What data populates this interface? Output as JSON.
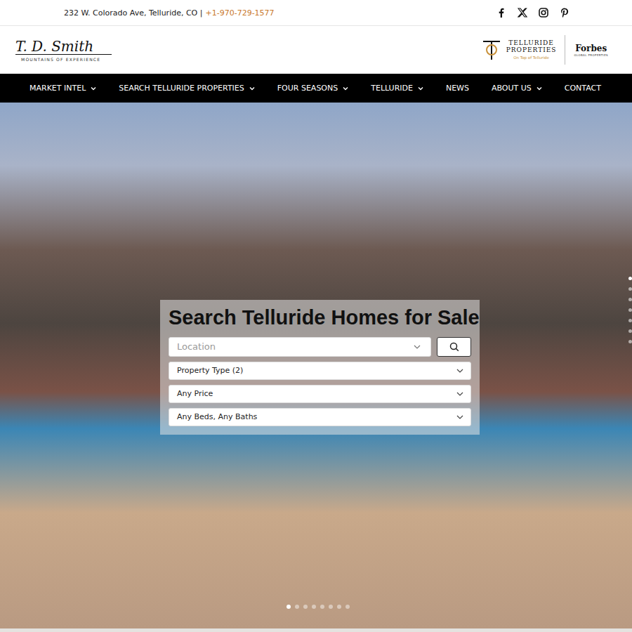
{
  "top_bar": {
    "address": "232 W. Colorado Ave, Telluride, CO |",
    "phone": "+1-970-729-1577",
    "social": [
      {
        "network": "facebook"
      },
      {
        "network": "x"
      },
      {
        "network": "instagram"
      },
      {
        "network": "pinterest"
      }
    ]
  },
  "header": {
    "logo": {
      "name": "T. D. Smith",
      "tagline": "MOUNTAINS OF EXPERIENCE"
    },
    "brand": {
      "line1": "TELLURIDE",
      "line2": "PROPERTIES",
      "slogan": "On Top of Telluride",
      "partner": "Forbes",
      "partner_sub": "GLOBAL PROPERTIES"
    }
  },
  "nav": [
    {
      "label": "MARKET INTEL",
      "dropdown": true
    },
    {
      "label": "SEARCH TELLURIDE PROPERTIES",
      "dropdown": true
    },
    {
      "label": "FOUR SEASONS",
      "dropdown": true
    },
    {
      "label": "TELLURIDE",
      "dropdown": true
    },
    {
      "label": "NEWS",
      "dropdown": false
    },
    {
      "label": "ABOUT US",
      "dropdown": true
    },
    {
      "label": "CONTACT",
      "dropdown": false
    }
  ],
  "hero": {
    "title": "Search Telluride Homes for Sale",
    "location": {
      "placeholder": "Location"
    },
    "filters": [
      {
        "label": "Property Type (2)"
      },
      {
        "label": "Any Price"
      },
      {
        "label": "Any Beds, Any Baths"
      }
    ],
    "slides": [
      {
        "selected": true
      },
      {
        "selected": false
      },
      {
        "selected": false
      },
      {
        "selected": false
      },
      {
        "selected": false
      },
      {
        "selected": false
      },
      {
        "selected": false
      },
      {
        "selected": false
      }
    ],
    "sections": [
      {
        "selected": true
      },
      {
        "selected": false
      },
      {
        "selected": false
      },
      {
        "selected": false
      },
      {
        "selected": false
      },
      {
        "selected": false
      },
      {
        "selected": false
      }
    ]
  }
}
